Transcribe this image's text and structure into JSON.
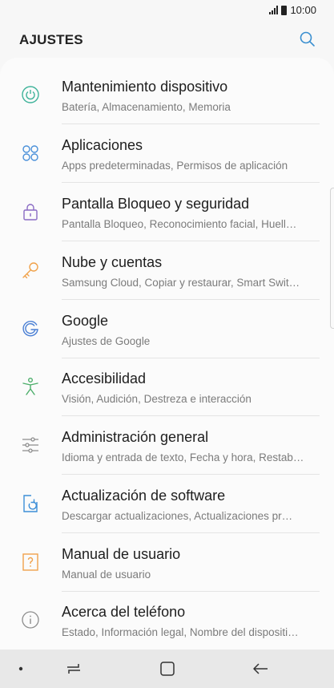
{
  "status_bar": {
    "time": "10:00"
  },
  "header": {
    "title": "AJUSTES"
  },
  "items": [
    {
      "label": "Mantenimiento dispositivo",
      "sub": "Batería, Almacenamiento, Memoria",
      "icon": "device-maintenance-icon",
      "color": "#3fb39a"
    },
    {
      "label": "Aplicaciones",
      "sub": "Apps predeterminadas, Permisos de aplicación",
      "icon": "apps-icon",
      "color": "#4a90d9"
    },
    {
      "label": "Pantalla Bloqueo y seguridad",
      "sub": "Pantalla Bloqueo, Reconocimiento facial, Huell…",
      "icon": "lock-icon",
      "color": "#8a6bc4"
    },
    {
      "label": "Nube y cuentas",
      "sub": "Samsung Cloud, Copiar y restaurar, Smart Swit…",
      "icon": "key-icon",
      "color": "#f0a24b"
    },
    {
      "label": "Google",
      "sub": "Ajustes de Google",
      "icon": "google-icon",
      "color": "#4a7fd4"
    },
    {
      "label": "Accesibilidad",
      "sub": "Visión, Audición, Destreza e interacción",
      "icon": "accessibility-icon",
      "color": "#4cae6a"
    },
    {
      "label": "Administración general",
      "sub": "Idioma y entrada de texto, Fecha y hora, Restab…",
      "icon": "sliders-icon",
      "color": "#8c8c8c"
    },
    {
      "label": "Actualización de software",
      "sub": "Descargar actualizaciones, Actualizaciones pr…",
      "icon": "software-update-icon",
      "color": "#3d8fd8"
    },
    {
      "label": "Manual de usuario",
      "sub": "Manual de usuario",
      "icon": "user-manual-icon",
      "color": "#f0a24b"
    },
    {
      "label": "Acerca del teléfono",
      "sub": "Estado, Información legal, Nombre del dispositi…",
      "icon": "info-icon",
      "color": "#8c8c8c"
    }
  ],
  "navbar": {
    "icons": [
      "dot-icon",
      "recents-icon",
      "home-icon",
      "back-icon"
    ]
  }
}
